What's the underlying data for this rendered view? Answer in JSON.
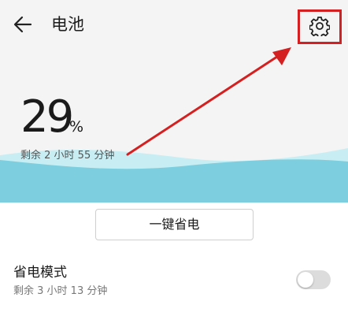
{
  "header": {
    "title": "电池",
    "back_icon": "back-arrow-icon",
    "settings_icon": "gear-icon"
  },
  "battery": {
    "percent_value": "29",
    "percent_unit": "%",
    "remaining": "剩余 2 小时 55 分钟"
  },
  "actions": {
    "one_key_label": "一键省电"
  },
  "power_saving_mode": {
    "label": "省电模式",
    "remaining": "剩余 3 小时 13 分钟",
    "enabled": false
  },
  "colors": {
    "highlight_border": "#d42020",
    "annotation_arrow": "#d42020",
    "wave": "#7dcfdf",
    "wave_light": "#c8eef4",
    "header_bg": "#f4f4f4"
  }
}
